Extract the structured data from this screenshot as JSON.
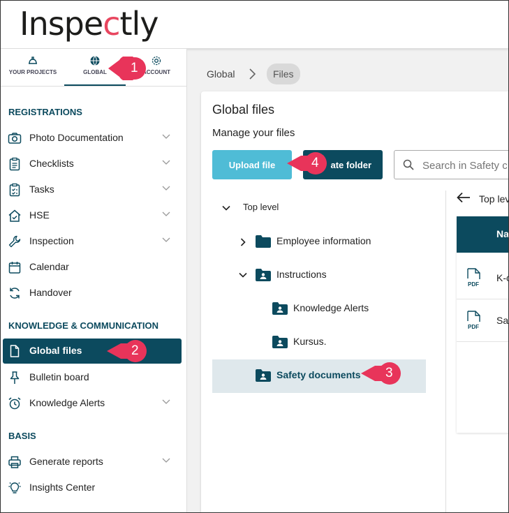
{
  "app": {
    "logo_text_1": "Inspe",
    "logo_text_accent": "c",
    "logo_text_2": "tly"
  },
  "sidebar": {
    "tabs": [
      {
        "label": "YOUR PROJECTS",
        "icon": "hardhat-icon"
      },
      {
        "label": "GLOBAL",
        "icon": "globe-icon"
      },
      {
        "label": "ACCOUNT",
        "icon": "gear-icon"
      }
    ],
    "sections": [
      {
        "title": "REGISTRATIONS"
      },
      {
        "title": "KNOWLEDGE & COMMUNICATION"
      },
      {
        "title": "BASIS"
      }
    ],
    "items": [
      {
        "label": "Photo Documentation",
        "icon": "camera-icon",
        "expandable": true
      },
      {
        "label": "Checklists",
        "icon": "clipboard-list-icon",
        "expandable": true
      },
      {
        "label": "Tasks",
        "icon": "clipboard-check-icon",
        "expandable": true
      },
      {
        "label": "HSE",
        "icon": "house-check-icon",
        "expandable": true
      },
      {
        "label": "Inspection",
        "icon": "wrench-icon",
        "expandable": true
      },
      {
        "label": "Calendar",
        "icon": "calendar-icon",
        "expandable": false
      },
      {
        "label": "Handover",
        "icon": "refresh-icon",
        "expandable": false
      },
      {
        "label": "Global files",
        "icon": "file-icon",
        "active": true
      },
      {
        "label": "Bulletin board",
        "icon": "pin-icon",
        "expandable": false
      },
      {
        "label": "Knowledge Alerts",
        "icon": "alarm-icon",
        "expandable": true
      },
      {
        "label": "Generate reports",
        "icon": "printer-icon",
        "expandable": true
      },
      {
        "label": "Insights Center",
        "icon": "lightbulb-icon",
        "expandable": false
      }
    ]
  },
  "breadcrumb": {
    "parent": "Global",
    "current": "Files"
  },
  "main": {
    "title": "Global files",
    "subtitle": "Manage your files",
    "upload_label": "Upload file",
    "create_folder_label": "ate folder",
    "search_placeholder": "Search in Safety c"
  },
  "tree": {
    "root": "Top level",
    "nodes": [
      {
        "label": "Employee information"
      },
      {
        "label": "Instructions"
      },
      {
        "label": "Knowledge Alerts"
      },
      {
        "label": "Kursus."
      },
      {
        "label": "Safety documents",
        "selected": true
      }
    ]
  },
  "files_pane": {
    "back_label": "Top lev",
    "header": "Na",
    "rows": [
      {
        "name": "K-c",
        "type": "PDF"
      },
      {
        "name": "Saf",
        "type": "PDF"
      }
    ]
  },
  "callouts": [
    "1",
    "2",
    "3",
    "4"
  ],
  "colors": {
    "primary": "#0c4a5e",
    "upload": "#4fbcd6",
    "callout": "#e8345a",
    "logo_accent": "#e8465f"
  }
}
